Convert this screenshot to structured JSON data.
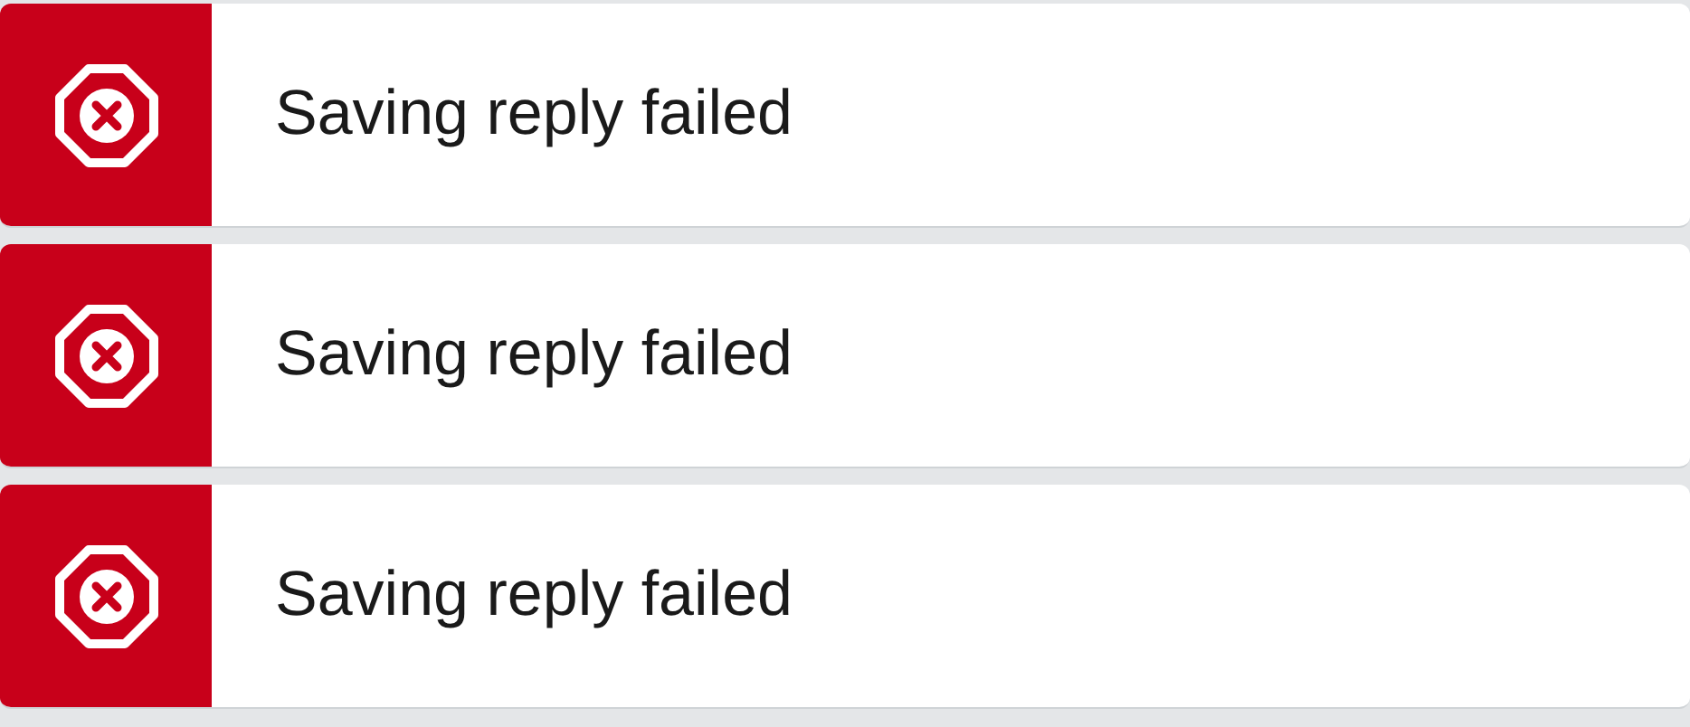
{
  "toasts": [
    {
      "kind": "error",
      "message": "Saving reply failed"
    },
    {
      "kind": "error",
      "message": "Saving reply failed"
    },
    {
      "kind": "error",
      "message": "Saving reply failed"
    }
  ]
}
